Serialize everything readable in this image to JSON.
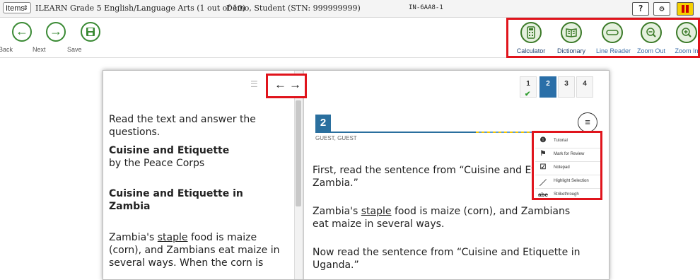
{
  "topbar": {
    "items_label": "Items",
    "test_title": "ILEARN Grade 5 English/Language Arts (1 out of 10)",
    "student": "Demo, Student (STN: 999999999)",
    "code": "IN-6AA8-1",
    "help_label": "?"
  },
  "toolbar": {
    "back_label": "Back",
    "next_label": "Next",
    "save_label": "Save",
    "calculator_label": "Calculator",
    "dictionary_label": "Dictionary",
    "line_reader_label": "Line Reader",
    "zoom_out_label": "Zoom Out",
    "zoom_in_label": "Zoom In"
  },
  "passage": {
    "instructions": "Read the text and answer the questions.",
    "title": "Cuisine and Etiquette",
    "byline": "by the Peace Corps",
    "section_heading": "Cuisine and Etiquette in Zambia",
    "body_pre": "Zambia's ",
    "body_word": "staple",
    "body_post": " food is maize (corn), and Zambians eat maize in several ways. When the corn is"
  },
  "question_tabs": [
    {
      "label": "1",
      "answered": true
    },
    {
      "label": "2",
      "active": true
    },
    {
      "label": "3"
    },
    {
      "label": "4"
    }
  ],
  "question": {
    "number": "2",
    "guest_label": "GUEST, GUEST",
    "line1": "First, read the sentence from “Cuisine and Etiquette in Zambia.”",
    "quote_pre": "Zambia's ",
    "quote_word": "staple",
    "quote_post": " food is maize (corn), and Zambians eat maize in several ways.",
    "line2": "Now read the sentence from “Cuisine and Etiquette in Uganda.”"
  },
  "context_menu": {
    "items": [
      {
        "icon": "info-icon",
        "label": "Tutorial"
      },
      {
        "icon": "flag-icon",
        "label": "Mark for Review"
      },
      {
        "icon": "notepad-icon",
        "label": "Notepad"
      },
      {
        "icon": "highlighter-icon",
        "label": "Highlight Selection"
      },
      {
        "icon": "strikethrough-icon",
        "label": "Strikethrough"
      }
    ]
  },
  "colors": {
    "accent_green": "#3a8a34",
    "question_blue": "#2a6f9e",
    "highlight_red": "#e0141c",
    "pause_yellow": "#f5d000"
  }
}
